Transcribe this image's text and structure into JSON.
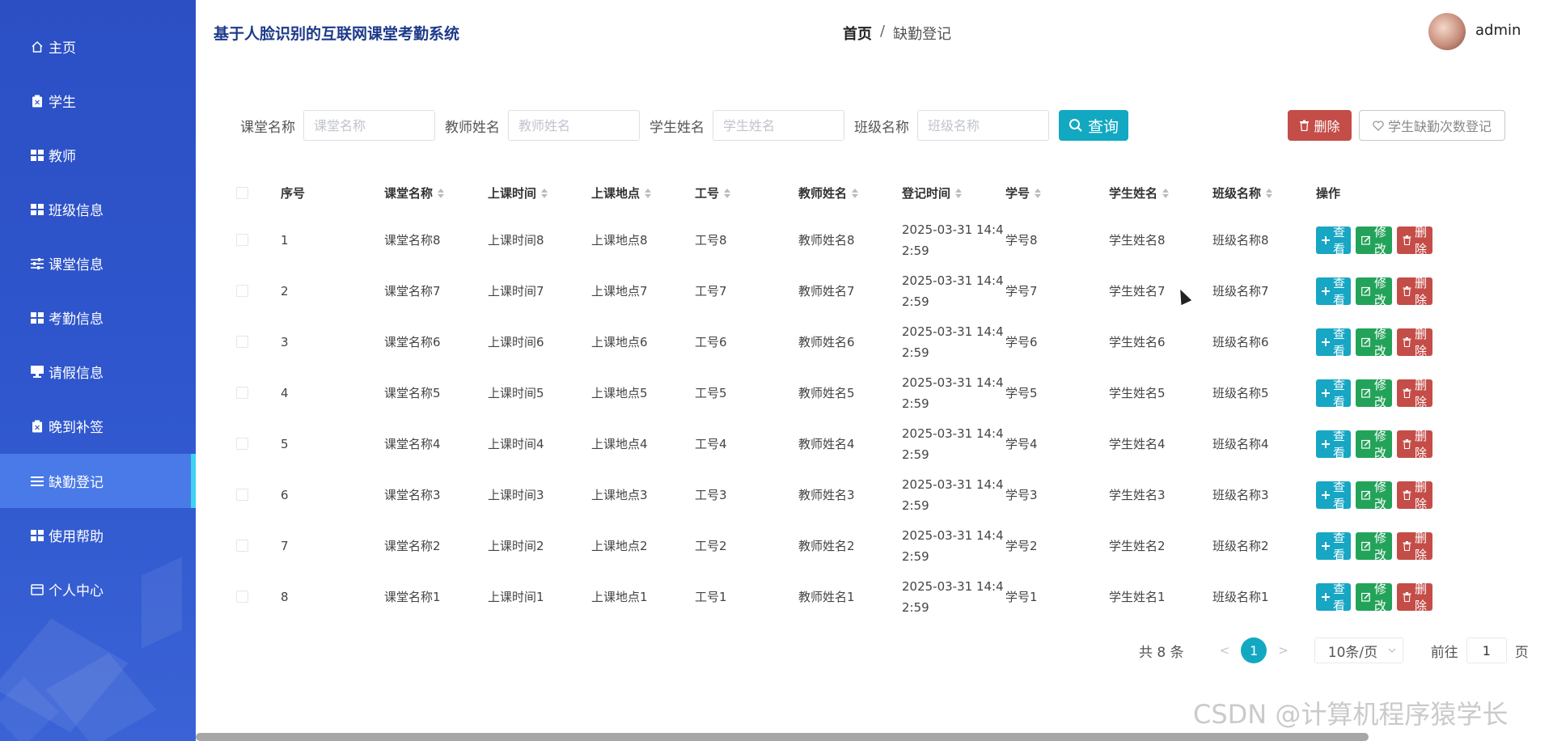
{
  "app": {
    "title": "基于人脸识别的互联网课堂考勤系统"
  },
  "breadcrumb": {
    "home": "首页",
    "separator": "/",
    "current": "缺勤登记"
  },
  "user": {
    "name": "admin"
  },
  "sidebar": {
    "items": [
      {
        "label": "主页",
        "icon": "home-icon"
      },
      {
        "label": "学生",
        "icon": "clipboard-icon"
      },
      {
        "label": "教师",
        "icon": "grid-icon"
      },
      {
        "label": "班级信息",
        "icon": "grid-icon"
      },
      {
        "label": "课堂信息",
        "icon": "sliders-icon"
      },
      {
        "label": "考勤信息",
        "icon": "grid-icon"
      },
      {
        "label": "请假信息",
        "icon": "monitor-icon"
      },
      {
        "label": "晚到补签",
        "icon": "clipboard-icon"
      },
      {
        "label": "缺勤登记",
        "icon": "list-icon"
      },
      {
        "label": "使用帮助",
        "icon": "grid-icon"
      },
      {
        "label": "个人中心",
        "icon": "card-icon"
      }
    ],
    "active_index": 8,
    "accent_color": "#3fd3f2"
  },
  "search": {
    "fields": [
      {
        "label": "课堂名称",
        "placeholder": "课堂名称"
      },
      {
        "label": "教师姓名",
        "placeholder": "教师姓名"
      },
      {
        "label": "学生姓名",
        "placeholder": "学生姓名"
      },
      {
        "label": "班级名称",
        "placeholder": "班级名称"
      }
    ],
    "query_label": "查询"
  },
  "toolbar": {
    "delete_label": "删除",
    "absent_register_label": "学生缺勤次数登记"
  },
  "table": {
    "columns": [
      "序号",
      "课堂名称",
      "上课时间",
      "上课地点",
      "工号",
      "教师姓名",
      "登记时间",
      "学号",
      "学生姓名",
      "班级名称",
      "操作"
    ],
    "rows": [
      {
        "index": "1",
        "course": "课堂名称8",
        "class_time": "上课时间8",
        "place": "上课地点8",
        "teacher_no": "工号8",
        "teacher": "教师姓名8",
        "reg_time": "2025-03-31 14:4\n2:59",
        "student_no": "学号8",
        "student": "学生姓名8",
        "class_name": "班级名称8"
      },
      {
        "index": "2",
        "course": "课堂名称7",
        "class_time": "上课时间7",
        "place": "上课地点7",
        "teacher_no": "工号7",
        "teacher": "教师姓名7",
        "reg_time": "2025-03-31 14:4\n2:59",
        "student_no": "学号7",
        "student": "学生姓名7",
        "class_name": "班级名称7"
      },
      {
        "index": "3",
        "course": "课堂名称6",
        "class_time": "上课时间6",
        "place": "上课地点6",
        "teacher_no": "工号6",
        "teacher": "教师姓名6",
        "reg_time": "2025-03-31 14:4\n2:59",
        "student_no": "学号6",
        "student": "学生姓名6",
        "class_name": "班级名称6"
      },
      {
        "index": "4",
        "course": "课堂名称5",
        "class_time": "上课时间5",
        "place": "上课地点5",
        "teacher_no": "工号5",
        "teacher": "教师姓名5",
        "reg_time": "2025-03-31 14:4\n2:59",
        "student_no": "学号5",
        "student": "学生姓名5",
        "class_name": "班级名称5"
      },
      {
        "index": "5",
        "course": "课堂名称4",
        "class_time": "上课时间4",
        "place": "上课地点4",
        "teacher_no": "工号4",
        "teacher": "教师姓名4",
        "reg_time": "2025-03-31 14:4\n2:59",
        "student_no": "学号4",
        "student": "学生姓名4",
        "class_name": "班级名称4"
      },
      {
        "index": "6",
        "course": "课堂名称3",
        "class_time": "上课时间3",
        "place": "上课地点3",
        "teacher_no": "工号3",
        "teacher": "教师姓名3",
        "reg_time": "2025-03-31 14:4\n2:59",
        "student_no": "学号3",
        "student": "学生姓名3",
        "class_name": "班级名称3"
      },
      {
        "index": "7",
        "course": "课堂名称2",
        "class_time": "上课时间2",
        "place": "上课地点2",
        "teacher_no": "工号2",
        "teacher": "教师姓名2",
        "reg_time": "2025-03-31 14:4\n2:59",
        "student_no": "学号2",
        "student": "学生姓名2",
        "class_name": "班级名称2"
      },
      {
        "index": "8",
        "course": "课堂名称1",
        "class_time": "上课时间1",
        "place": "上课地点1",
        "teacher_no": "工号1",
        "teacher": "教师姓名1",
        "reg_time": "2025-03-31 14:4\n2:59",
        "student_no": "学号1",
        "student": "学生姓名1",
        "class_name": "班级名称1"
      }
    ],
    "actions": {
      "view": "查看",
      "edit": "修改",
      "delete": "删除"
    }
  },
  "pagination": {
    "total": "共 8 条",
    "prev": "<",
    "current_page": "1",
    "next": ">",
    "page_size": "10条/页",
    "goto_label": "前往",
    "goto_value": "1",
    "goto_suffix": "页"
  },
  "watermark": "CSDN @计算机程序猿学长",
  "colors": {
    "primary": "#12a8c2",
    "danger": "#c44d48",
    "success": "#23a35a",
    "sidebar": "#2f56cd",
    "sidebar_active": "#4a7ae8"
  }
}
